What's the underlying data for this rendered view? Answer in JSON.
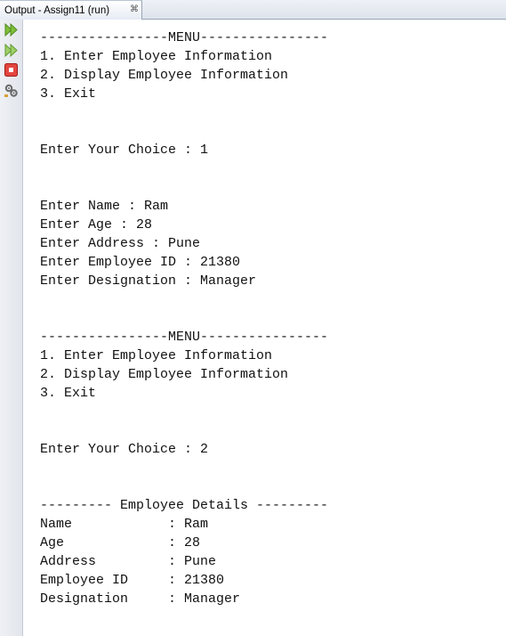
{
  "window": {
    "tab_title": "Output - Assign11 (run)",
    "close_glyph": "⌘"
  },
  "toolbar": {
    "buttons": [
      {
        "name": "rerun-icon"
      },
      {
        "name": "rerun-with-options-icon"
      },
      {
        "name": "stop-icon"
      },
      {
        "name": "settings-icon"
      }
    ]
  },
  "console": {
    "lines": [
      "----------------MENU----------------",
      "1. Enter Employee Information",
      "2. Display Employee Information",
      "3. Exit",
      "",
      "",
      "Enter Your Choice : 1",
      "",
      "",
      "Enter Name : Ram",
      "Enter Age : 28",
      "Enter Address : Pune",
      "Enter Employee ID : 21380",
      "Enter Designation : Manager",
      "",
      "",
      "----------------MENU----------------",
      "1. Enter Employee Information",
      "2. Display Employee Information",
      "3. Exit",
      "",
      "",
      "Enter Your Choice : 2",
      "",
      "",
      "--------- Employee Details ---------",
      "Name            : Ram",
      "Age             : 28",
      "Address         : Pune",
      "Employee ID     : 21380",
      "Designation     : Manager"
    ]
  }
}
